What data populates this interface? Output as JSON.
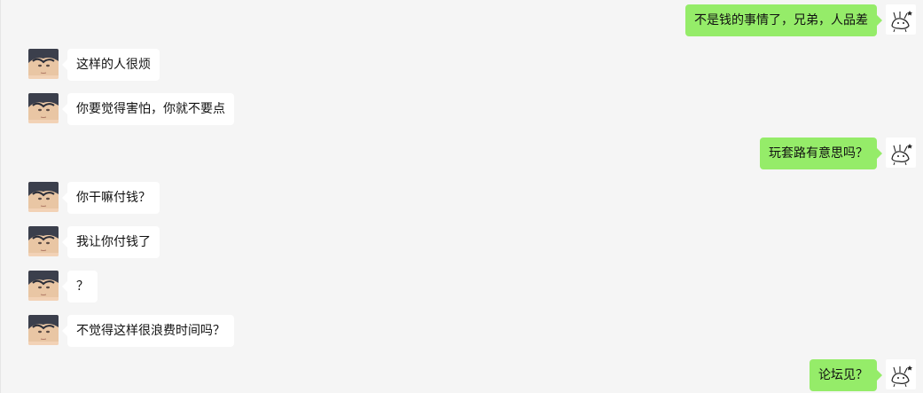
{
  "messages": [
    {
      "side": "right",
      "text": "不是钱的事情了，兄弟，人品差",
      "avatar": "self-avatar-sketch"
    },
    {
      "side": "left",
      "text": "这样的人很烦",
      "avatar": "contact-avatar-anime"
    },
    {
      "side": "left",
      "text": "你要觉得害怕，你就不要点",
      "avatar": "contact-avatar-anime"
    },
    {
      "side": "right",
      "text": "玩套路有意思吗？",
      "avatar": "self-avatar-sketch"
    },
    {
      "side": "left",
      "text": "你干嘛付钱？",
      "avatar": "contact-avatar-anime"
    },
    {
      "side": "left",
      "text": "我让你付钱了",
      "avatar": "contact-avatar-anime"
    },
    {
      "side": "left",
      "text": "？",
      "avatar": "contact-avatar-anime"
    },
    {
      "side": "left",
      "text": "不觉得这样很浪费时间吗？",
      "avatar": "contact-avatar-anime"
    },
    {
      "side": "right",
      "text": "论坛见？",
      "avatar": "self-avatar-sketch"
    }
  ],
  "colors": {
    "background": "#f5f5f5",
    "bubble_self": "#95ec69",
    "bubble_other": "#ffffff",
    "text": "#111111"
  }
}
